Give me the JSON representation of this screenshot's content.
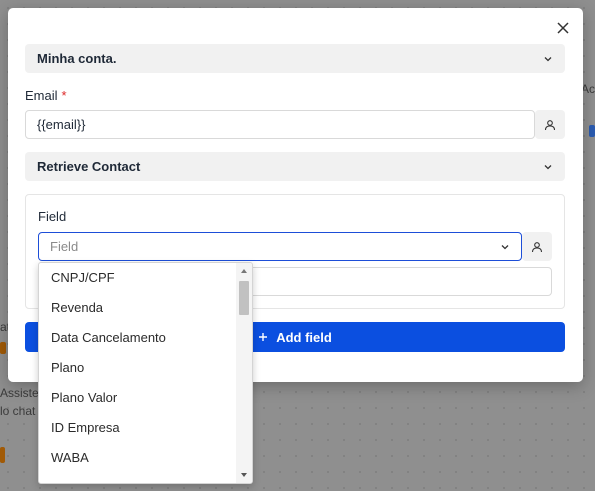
{
  "background": {
    "right_top_text": "Ac",
    "left_text_1": "at",
    "left_text_2": "Assiste",
    "left_text_3": "lo chat"
  },
  "modal": {
    "section1_title": "Minha conta.",
    "email_label": "Email",
    "email_required_mark": "*",
    "email_value": "{{email}}",
    "section2_title": "Retrieve Contact",
    "field_label": "Field",
    "field_placeholder": "Field",
    "add_field_label": "Add field"
  },
  "dropdown": {
    "options": [
      "CNPJ/CPF",
      "Revenda",
      "Data Cancelamento",
      "Plano",
      "Plano Valor",
      "ID Empresa",
      "WABA"
    ]
  },
  "colors": {
    "accent": "#0b4fe0",
    "required": "#dc2626",
    "focus_border": "#1d4ed8"
  }
}
